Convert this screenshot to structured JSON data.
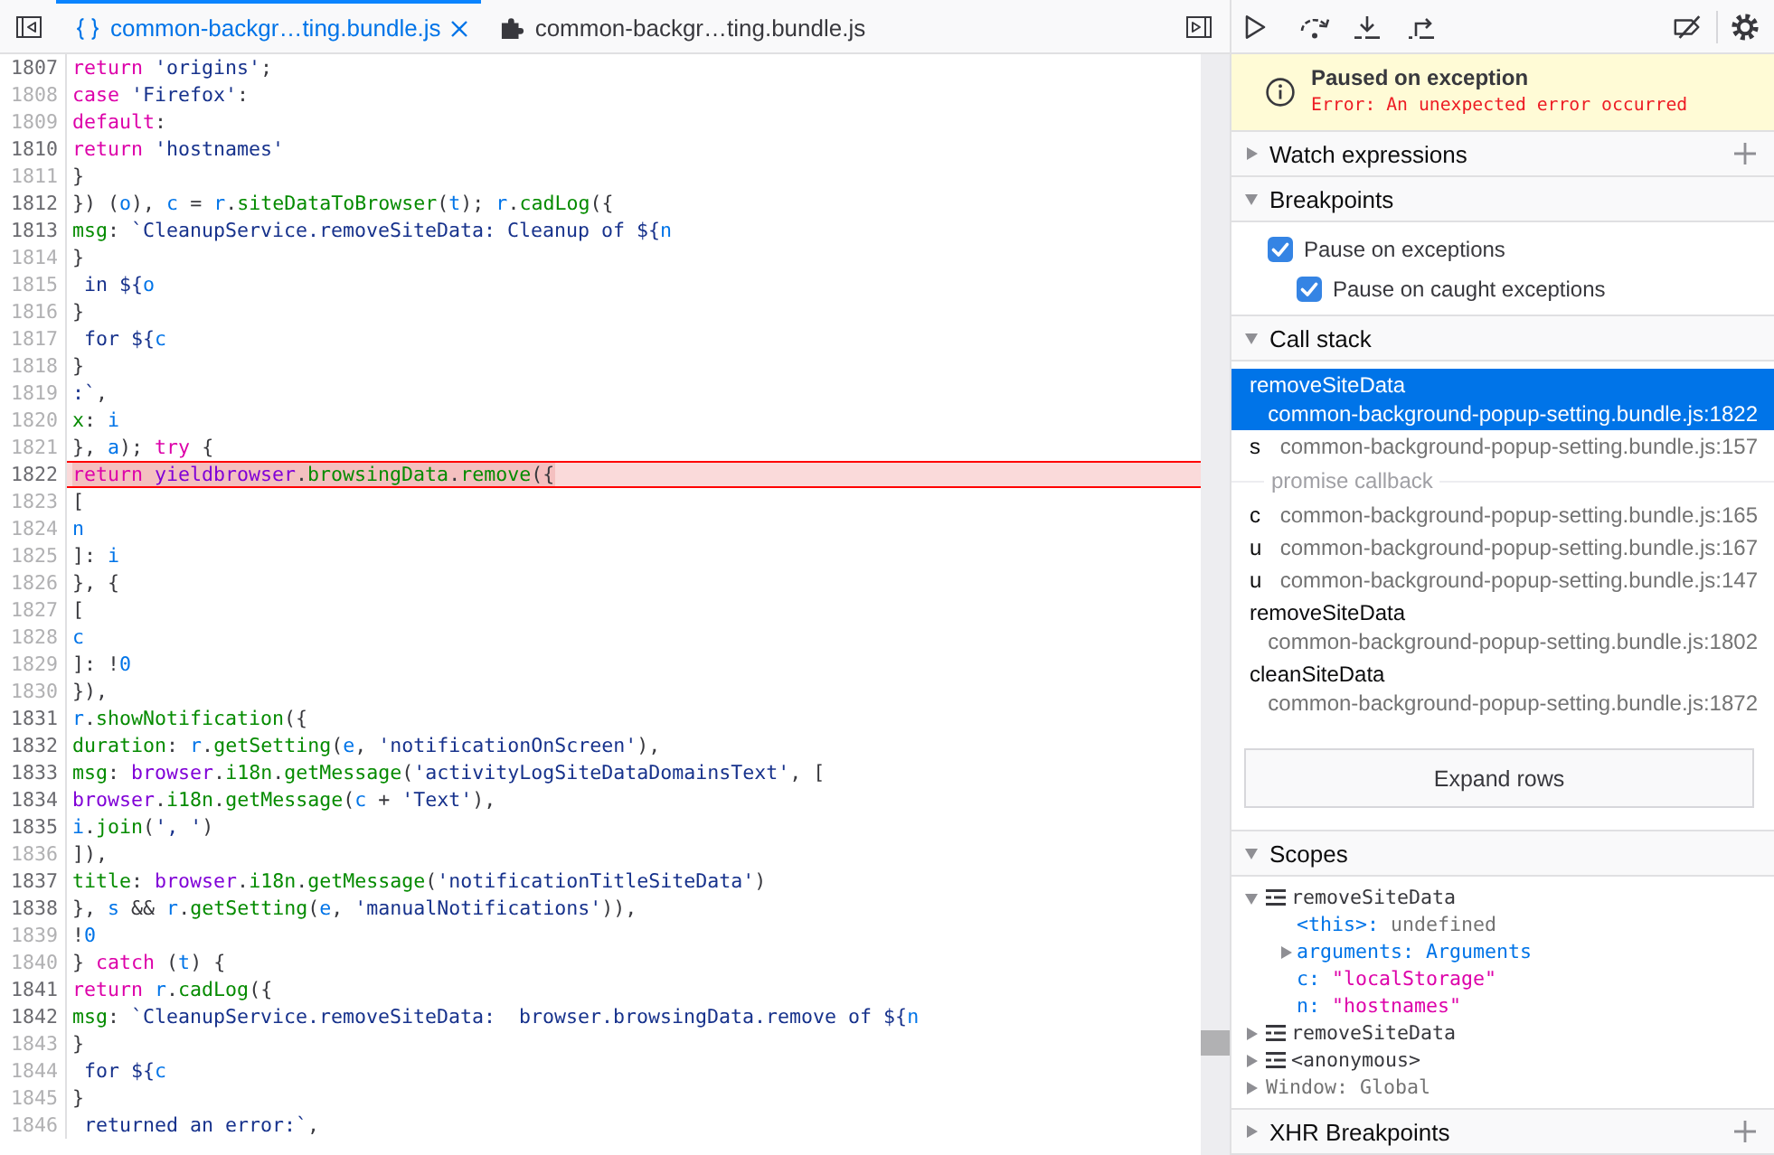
{
  "editor": {
    "tabs": [
      {
        "kind": "pretty",
        "label": "common-backgr…ting.bundle.js",
        "selected": true
      },
      {
        "kind": "extension",
        "label": "common-backgr…ting.bundle.js",
        "selected": false
      }
    ],
    "lines": [
      {
        "number": "1807",
        "breakable": true,
        "highlighted": false,
        "tokens": [
          {
            "kind": "keyword",
            "text": "return "
          },
          {
            "kind": "string",
            "text": "'origins'"
          },
          {
            "kind": "plain",
            "text": ";"
          }
        ]
      },
      {
        "number": "1808",
        "breakable": false,
        "highlighted": false,
        "tokens": [
          {
            "kind": "keyword",
            "text": "case "
          },
          {
            "kind": "string",
            "text": "'Firefox'"
          },
          {
            "kind": "plain",
            "text": ":"
          }
        ]
      },
      {
        "number": "1809",
        "breakable": false,
        "highlighted": false,
        "tokens": [
          {
            "kind": "keyword",
            "text": "default"
          },
          {
            "kind": "plain",
            "text": ":"
          }
        ]
      },
      {
        "number": "1810",
        "breakable": true,
        "highlighted": false,
        "tokens": [
          {
            "kind": "keyword",
            "text": "return "
          },
          {
            "kind": "string",
            "text": "'hostnames'"
          }
        ]
      },
      {
        "number": "1811",
        "breakable": false,
        "highlighted": false,
        "tokens": [
          {
            "kind": "plain",
            "text": "}"
          }
        ]
      },
      {
        "number": "1812",
        "breakable": true,
        "highlighted": false,
        "tokens": [
          {
            "kind": "plain",
            "text": "}) ("
          },
          {
            "kind": "variable",
            "text": "o"
          },
          {
            "kind": "plain",
            "text": "), "
          },
          {
            "kind": "variable",
            "text": "c"
          },
          {
            "kind": "plain",
            "text": " = "
          },
          {
            "kind": "variable",
            "text": "r"
          },
          {
            "kind": "plain",
            "text": "."
          },
          {
            "kind": "property",
            "text": "siteDataToBrowser"
          },
          {
            "kind": "plain",
            "text": "("
          },
          {
            "kind": "variable",
            "text": "t"
          },
          {
            "kind": "plain",
            "text": "); "
          },
          {
            "kind": "variable",
            "text": "r"
          },
          {
            "kind": "plain",
            "text": "."
          },
          {
            "kind": "property",
            "text": "cadLog"
          },
          {
            "kind": "plain",
            "text": "({"
          }
        ]
      },
      {
        "number": "1813",
        "breakable": true,
        "highlighted": false,
        "tokens": [
          {
            "kind": "property",
            "text": "msg"
          },
          {
            "kind": "plain",
            "text": ": "
          },
          {
            "kind": "string",
            "text": "`CleanupService.removeSiteData: Cleanup of ${"
          },
          {
            "kind": "variable",
            "text": "n"
          }
        ]
      },
      {
        "number": "1814",
        "breakable": false,
        "highlighted": false,
        "tokens": [
          {
            "kind": "plain",
            "text": "}"
          }
        ]
      },
      {
        "number": "1815",
        "breakable": false,
        "highlighted": false,
        "tokens": [
          {
            "kind": "string",
            "text": " in ${"
          },
          {
            "kind": "variable",
            "text": "o"
          }
        ]
      },
      {
        "number": "1816",
        "breakable": false,
        "highlighted": false,
        "tokens": [
          {
            "kind": "plain",
            "text": "}"
          }
        ]
      },
      {
        "number": "1817",
        "breakable": false,
        "highlighted": false,
        "tokens": [
          {
            "kind": "string",
            "text": " for ${"
          },
          {
            "kind": "variable",
            "text": "c"
          }
        ]
      },
      {
        "number": "1818",
        "breakable": false,
        "highlighted": false,
        "tokens": [
          {
            "kind": "plain",
            "text": "}"
          }
        ]
      },
      {
        "number": "1819",
        "breakable": false,
        "highlighted": false,
        "tokens": [
          {
            "kind": "string",
            "text": ":`"
          },
          {
            "kind": "plain",
            "text": ","
          }
        ]
      },
      {
        "number": "1820",
        "breakable": false,
        "highlighted": false,
        "tokens": [
          {
            "kind": "property",
            "text": "x"
          },
          {
            "kind": "plain",
            "text": ": "
          },
          {
            "kind": "variable",
            "text": "i"
          }
        ]
      },
      {
        "number": "1821",
        "breakable": false,
        "highlighted": false,
        "tokens": [
          {
            "kind": "plain",
            "text": "}, "
          },
          {
            "kind": "variable",
            "text": "a"
          },
          {
            "kind": "plain",
            "text": "); "
          },
          {
            "kind": "keyword",
            "text": "try"
          },
          {
            "kind": "plain",
            "text": " {"
          }
        ]
      },
      {
        "number": "1822",
        "breakable": true,
        "highlighted": true,
        "tokens": [
          {
            "kind": "keyword",
            "text": "return "
          },
          {
            "kind": "global",
            "text": "yieldbrowser"
          },
          {
            "kind": "plain",
            "text": "."
          },
          {
            "kind": "property",
            "text": "browsingData"
          },
          {
            "kind": "plain",
            "text": "."
          },
          {
            "kind": "property",
            "text": "remove"
          },
          {
            "kind": "plain",
            "text": "({"
          }
        ]
      },
      {
        "number": "1823",
        "breakable": false,
        "highlighted": false,
        "tokens": [
          {
            "kind": "plain",
            "text": "["
          }
        ]
      },
      {
        "number": "1824",
        "breakable": false,
        "highlighted": false,
        "tokens": [
          {
            "kind": "variable",
            "text": "n"
          }
        ]
      },
      {
        "number": "1825",
        "breakable": false,
        "highlighted": false,
        "tokens": [
          {
            "kind": "plain",
            "text": "]: "
          },
          {
            "kind": "variable",
            "text": "i"
          }
        ]
      },
      {
        "number": "1826",
        "breakable": false,
        "highlighted": false,
        "tokens": [
          {
            "kind": "plain",
            "text": "}, {"
          }
        ]
      },
      {
        "number": "1827",
        "breakable": false,
        "highlighted": false,
        "tokens": [
          {
            "kind": "plain",
            "text": "["
          }
        ]
      },
      {
        "number": "1828",
        "breakable": false,
        "highlighted": false,
        "tokens": [
          {
            "kind": "variable",
            "text": "c"
          }
        ]
      },
      {
        "number": "1829",
        "breakable": false,
        "highlighted": false,
        "tokens": [
          {
            "kind": "plain",
            "text": "]: !"
          },
          {
            "kind": "number",
            "text": "0"
          }
        ]
      },
      {
        "number": "1830",
        "breakable": false,
        "highlighted": false,
        "tokens": [
          {
            "kind": "plain",
            "text": "}),"
          }
        ]
      },
      {
        "number": "1831",
        "breakable": true,
        "highlighted": false,
        "tokens": [
          {
            "kind": "variable",
            "text": "r"
          },
          {
            "kind": "plain",
            "text": "."
          },
          {
            "kind": "property",
            "text": "showNotification"
          },
          {
            "kind": "plain",
            "text": "({"
          }
        ]
      },
      {
        "number": "1832",
        "breakable": true,
        "highlighted": false,
        "tokens": [
          {
            "kind": "property",
            "text": "duration"
          },
          {
            "kind": "plain",
            "text": ": "
          },
          {
            "kind": "variable",
            "text": "r"
          },
          {
            "kind": "plain",
            "text": "."
          },
          {
            "kind": "property",
            "text": "getSetting"
          },
          {
            "kind": "plain",
            "text": "("
          },
          {
            "kind": "variable",
            "text": "e"
          },
          {
            "kind": "plain",
            "text": ", "
          },
          {
            "kind": "string",
            "text": "'notificationOnScreen'"
          },
          {
            "kind": "plain",
            "text": "),"
          }
        ]
      },
      {
        "number": "1833",
        "breakable": true,
        "highlighted": false,
        "tokens": [
          {
            "kind": "property",
            "text": "msg"
          },
          {
            "kind": "plain",
            "text": ": "
          },
          {
            "kind": "global",
            "text": "browser"
          },
          {
            "kind": "plain",
            "text": "."
          },
          {
            "kind": "property",
            "text": "i18n"
          },
          {
            "kind": "plain",
            "text": "."
          },
          {
            "kind": "property",
            "text": "getMessage"
          },
          {
            "kind": "plain",
            "text": "("
          },
          {
            "kind": "string",
            "text": "'activityLogSiteDataDomainsText'"
          },
          {
            "kind": "plain",
            "text": ", ["
          }
        ]
      },
      {
        "number": "1834",
        "breakable": true,
        "highlighted": false,
        "tokens": [
          {
            "kind": "global",
            "text": "browser"
          },
          {
            "kind": "plain",
            "text": "."
          },
          {
            "kind": "property",
            "text": "i18n"
          },
          {
            "kind": "plain",
            "text": "."
          },
          {
            "kind": "property",
            "text": "getMessage"
          },
          {
            "kind": "plain",
            "text": "("
          },
          {
            "kind": "variable",
            "text": "c"
          },
          {
            "kind": "plain",
            "text": " + "
          },
          {
            "kind": "string",
            "text": "'Text'"
          },
          {
            "kind": "plain",
            "text": "),"
          }
        ]
      },
      {
        "number": "1835",
        "breakable": true,
        "highlighted": false,
        "tokens": [
          {
            "kind": "variable",
            "text": "i"
          },
          {
            "kind": "plain",
            "text": "."
          },
          {
            "kind": "property",
            "text": "join"
          },
          {
            "kind": "plain",
            "text": "("
          },
          {
            "kind": "string",
            "text": "', '"
          },
          {
            "kind": "plain",
            "text": ")"
          }
        ]
      },
      {
        "number": "1836",
        "breakable": false,
        "highlighted": false,
        "tokens": [
          {
            "kind": "plain",
            "text": "]),"
          }
        ]
      },
      {
        "number": "1837",
        "breakable": true,
        "highlighted": false,
        "tokens": [
          {
            "kind": "property",
            "text": "title"
          },
          {
            "kind": "plain",
            "text": ": "
          },
          {
            "kind": "global",
            "text": "browser"
          },
          {
            "kind": "plain",
            "text": "."
          },
          {
            "kind": "property",
            "text": "i18n"
          },
          {
            "kind": "plain",
            "text": "."
          },
          {
            "kind": "property",
            "text": "getMessage"
          },
          {
            "kind": "plain",
            "text": "("
          },
          {
            "kind": "string",
            "text": "'notificationTitleSiteData'"
          },
          {
            "kind": "plain",
            "text": ")"
          }
        ]
      },
      {
        "number": "1838",
        "breakable": true,
        "highlighted": false,
        "tokens": [
          {
            "kind": "plain",
            "text": "}, "
          },
          {
            "kind": "variable",
            "text": "s"
          },
          {
            "kind": "plain",
            "text": " && "
          },
          {
            "kind": "variable",
            "text": "r"
          },
          {
            "kind": "plain",
            "text": "."
          },
          {
            "kind": "property",
            "text": "getSetting"
          },
          {
            "kind": "plain",
            "text": "("
          },
          {
            "kind": "variable",
            "text": "e"
          },
          {
            "kind": "plain",
            "text": ", "
          },
          {
            "kind": "string",
            "text": "'manualNotifications'"
          },
          {
            "kind": "plain",
            "text": ")),"
          }
        ]
      },
      {
        "number": "1839",
        "breakable": false,
        "highlighted": false,
        "tokens": [
          {
            "kind": "plain",
            "text": "!"
          },
          {
            "kind": "number",
            "text": "0"
          }
        ]
      },
      {
        "number": "1840",
        "breakable": false,
        "highlighted": false,
        "tokens": [
          {
            "kind": "plain",
            "text": "} "
          },
          {
            "kind": "keyword",
            "text": "catch"
          },
          {
            "kind": "plain",
            "text": " ("
          },
          {
            "kind": "variable",
            "text": "t"
          },
          {
            "kind": "plain",
            "text": ") {"
          }
        ]
      },
      {
        "number": "1841",
        "breakable": true,
        "highlighted": false,
        "tokens": [
          {
            "kind": "keyword",
            "text": "return "
          },
          {
            "kind": "variable",
            "text": "r"
          },
          {
            "kind": "plain",
            "text": "."
          },
          {
            "kind": "property",
            "text": "cadLog"
          },
          {
            "kind": "plain",
            "text": "({"
          }
        ]
      },
      {
        "number": "1842",
        "breakable": true,
        "highlighted": false,
        "tokens": [
          {
            "kind": "property",
            "text": "msg"
          },
          {
            "kind": "plain",
            "text": ": "
          },
          {
            "kind": "string",
            "text": "`CleanupService.removeSiteData:  browser.browsingData.remove of ${"
          },
          {
            "kind": "variable",
            "text": "n"
          }
        ]
      },
      {
        "number": "1843",
        "breakable": false,
        "highlighted": false,
        "tokens": [
          {
            "kind": "plain",
            "text": "}"
          }
        ]
      },
      {
        "number": "1844",
        "breakable": false,
        "highlighted": false,
        "tokens": [
          {
            "kind": "string",
            "text": " for ${"
          },
          {
            "kind": "variable",
            "text": "c"
          }
        ]
      },
      {
        "number": "1845",
        "breakable": false,
        "highlighted": false,
        "tokens": [
          {
            "kind": "plain",
            "text": "}"
          }
        ]
      },
      {
        "number": "1846",
        "breakable": false,
        "highlighted": false,
        "tokens": [
          {
            "kind": "string",
            "text": " returned an error:`"
          },
          {
            "kind": "plain",
            "text": ","
          }
        ]
      }
    ]
  },
  "sidebar": {
    "banner": {
      "title": "Paused on exception",
      "message": "Error: An unexpected error occurred"
    },
    "sections": [
      {
        "kind": "watch",
        "title": "Watch expressions",
        "expanded": false
      },
      {
        "kind": "breakpoints",
        "title": "Breakpoints",
        "expanded": true,
        "options": [
          {
            "label": "Pause on exceptions",
            "checked": true,
            "children": [
              {
                "label": "Pause on caught exceptions",
                "checked": true
              }
            ]
          }
        ]
      },
      {
        "kind": "call-stack",
        "title": "Call stack",
        "expanded": true,
        "frames": [
          {
            "kind": "frame",
            "name": "removeSiteData",
            "location": "common-background-popup-setting.bundle.js:1822",
            "selected": true
          },
          {
            "kind": "frame",
            "name": "s",
            "location": "common-background-popup-setting.bundle.js:157",
            "selected": false
          },
          {
            "kind": "async",
            "label": "promise callback"
          },
          {
            "kind": "frame",
            "name": "c",
            "location": "common-background-popup-setting.bundle.js:165",
            "selected": false
          },
          {
            "kind": "frame",
            "name": "u",
            "location": "common-background-popup-setting.bundle.js:167",
            "selected": false
          },
          {
            "kind": "frame",
            "name": "u",
            "location": "common-background-popup-setting.bundle.js:147",
            "selected": false
          },
          {
            "kind": "frame",
            "name": "removeSiteData",
            "location": "common-background-popup-setting.bundle.js:1802",
            "selected": false
          },
          {
            "kind": "frame",
            "name": "cleanSiteData",
            "location": "common-background-popup-setting.bundle.js:1872",
            "selected": false
          }
        ],
        "expand_button": "Expand rows"
      },
      {
        "kind": "scopes",
        "title": "Scopes",
        "expanded": true,
        "scopes": [
          {
            "kind": "block",
            "name": "removeSiteData",
            "expanded": true,
            "children": [
              {
                "kind": "undefined",
                "name": "<this>:",
                "value": "undefined"
              },
              {
                "kind": "object",
                "name": "arguments:",
                "value": "Arguments",
                "expanded": false
              },
              {
                "kind": "string",
                "name": "c:",
                "value": "\"localStorage\""
              },
              {
                "kind": "string",
                "name": "n:",
                "value": "\"hostnames\""
              }
            ]
          },
          {
            "kind": "block",
            "name": "removeSiteData",
            "expanded": false
          },
          {
            "kind": "block",
            "name": "<anonymous>",
            "expanded": false
          },
          {
            "kind": "global",
            "name": "Window: Global",
            "expanded": false
          }
        ]
      },
      {
        "kind": "xhr",
        "title": "XHR Breakpoints",
        "expanded": false
      }
    ]
  }
}
